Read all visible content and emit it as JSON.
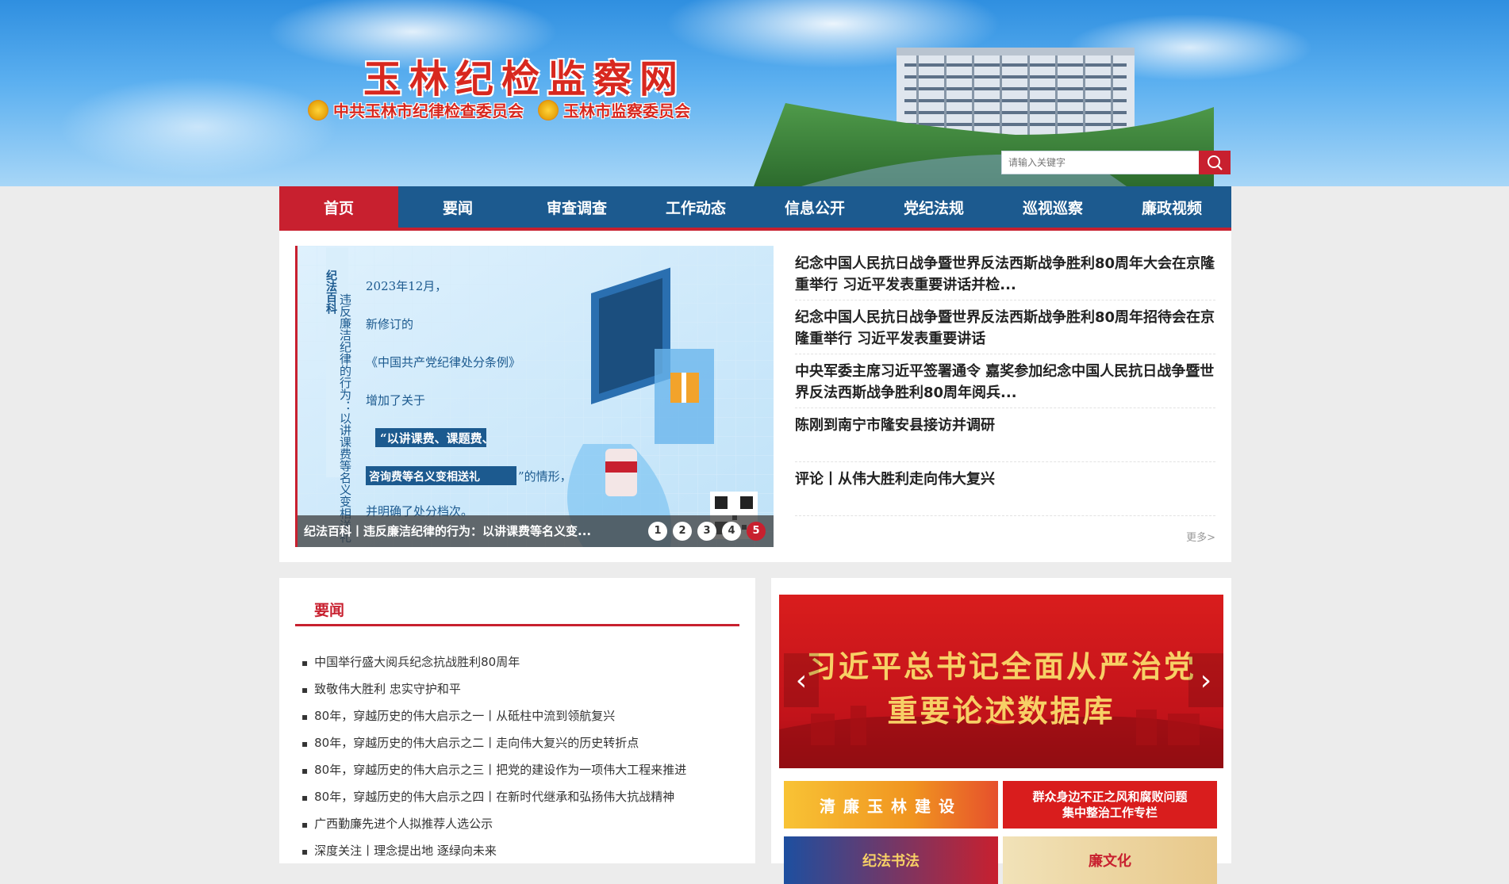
{
  "header": {
    "site_title": "玉林纪检监察网",
    "subtitle_left": "中共玉林市纪律检查委员会",
    "subtitle_right": "玉林市监察委员会",
    "search_placeholder": "请输入关键字"
  },
  "nav": {
    "items": [
      "首页",
      "要闻",
      "审查调查",
      "工作动态",
      "信息公开",
      "党纪法规",
      "巡视巡察",
      "廉政视频"
    ],
    "active_index": 0
  },
  "slider": {
    "caption": "纪法百科丨违反廉洁纪律的行为：以讲课费等名义变...",
    "image_lines": {
      "vertical_title": "纪法百科",
      "vertical_text": "违反廉洁纪律的行为：以讲课费等名义变相送礼",
      "date": "2023年12月，",
      "line2": "新修订的",
      "line3": "《中国共产党纪律处分条例》",
      "line4": "增加了关于",
      "highlight1": "“以讲课费、课题费、",
      "highlight2": "咨询费等名义变相送礼",
      "line5": "”的情形，",
      "line6": "并明确了处分档次。"
    },
    "dots": [
      "1",
      "2",
      "3",
      "4",
      "5"
    ],
    "active_dot": 4
  },
  "headlines": [
    "纪念中国人民抗日战争暨世界反法西斯战争胜利80周年大会在京隆重举行 习近平发表重要讲话并检...",
    "纪念中国人民抗日战争暨世界反法西斯战争胜利80周年招待会在京隆重举行 习近平发表重要讲话",
    "中央军委主席习近平签署通令 嘉奖参加纪念中国人民抗日战争暨世界反法西斯战争胜利80周年阅兵...",
    "陈刚到南宁市隆安县接访并调研",
    "评论丨从伟大胜利走向伟大复兴"
  ],
  "more_label": "更多>",
  "news": {
    "title": "要闻",
    "items": [
      "中国举行盛大阅兵纪念抗战胜利80周年",
      "致敬伟大胜利 忠实守护和平",
      "80年，穿越历史的伟大启示之一丨从砥柱中流到领航复兴",
      "80年，穿越历史的伟大启示之二丨走向伟大复兴的历史转折点",
      "80年，穿越历史的伟大启示之三丨把党的建设作为一项伟大工程来推进",
      "80年，穿越历史的伟大启示之四丨在新时代继承和弘扬伟大抗战精神",
      "广西勤廉先进个人拟推荐人选公示",
      "深度关注丨理念提出地 逐绿向未来"
    ]
  },
  "banner": {
    "line1": "习近平总书记全面从严治党",
    "line2": "重要论述数据库"
  },
  "tiles": {
    "tile1": "清廉玉林建设",
    "tile2_line1": "群众身边不正之风和腐败问题",
    "tile2_line2": "集中整治工作专栏",
    "tile3": "纪法书法",
    "tile4": "廉文化"
  },
  "colors": {
    "brand_red": "#c8202f",
    "nav_blue": "#1c5a8f",
    "banner_gold": "#f7d066"
  }
}
